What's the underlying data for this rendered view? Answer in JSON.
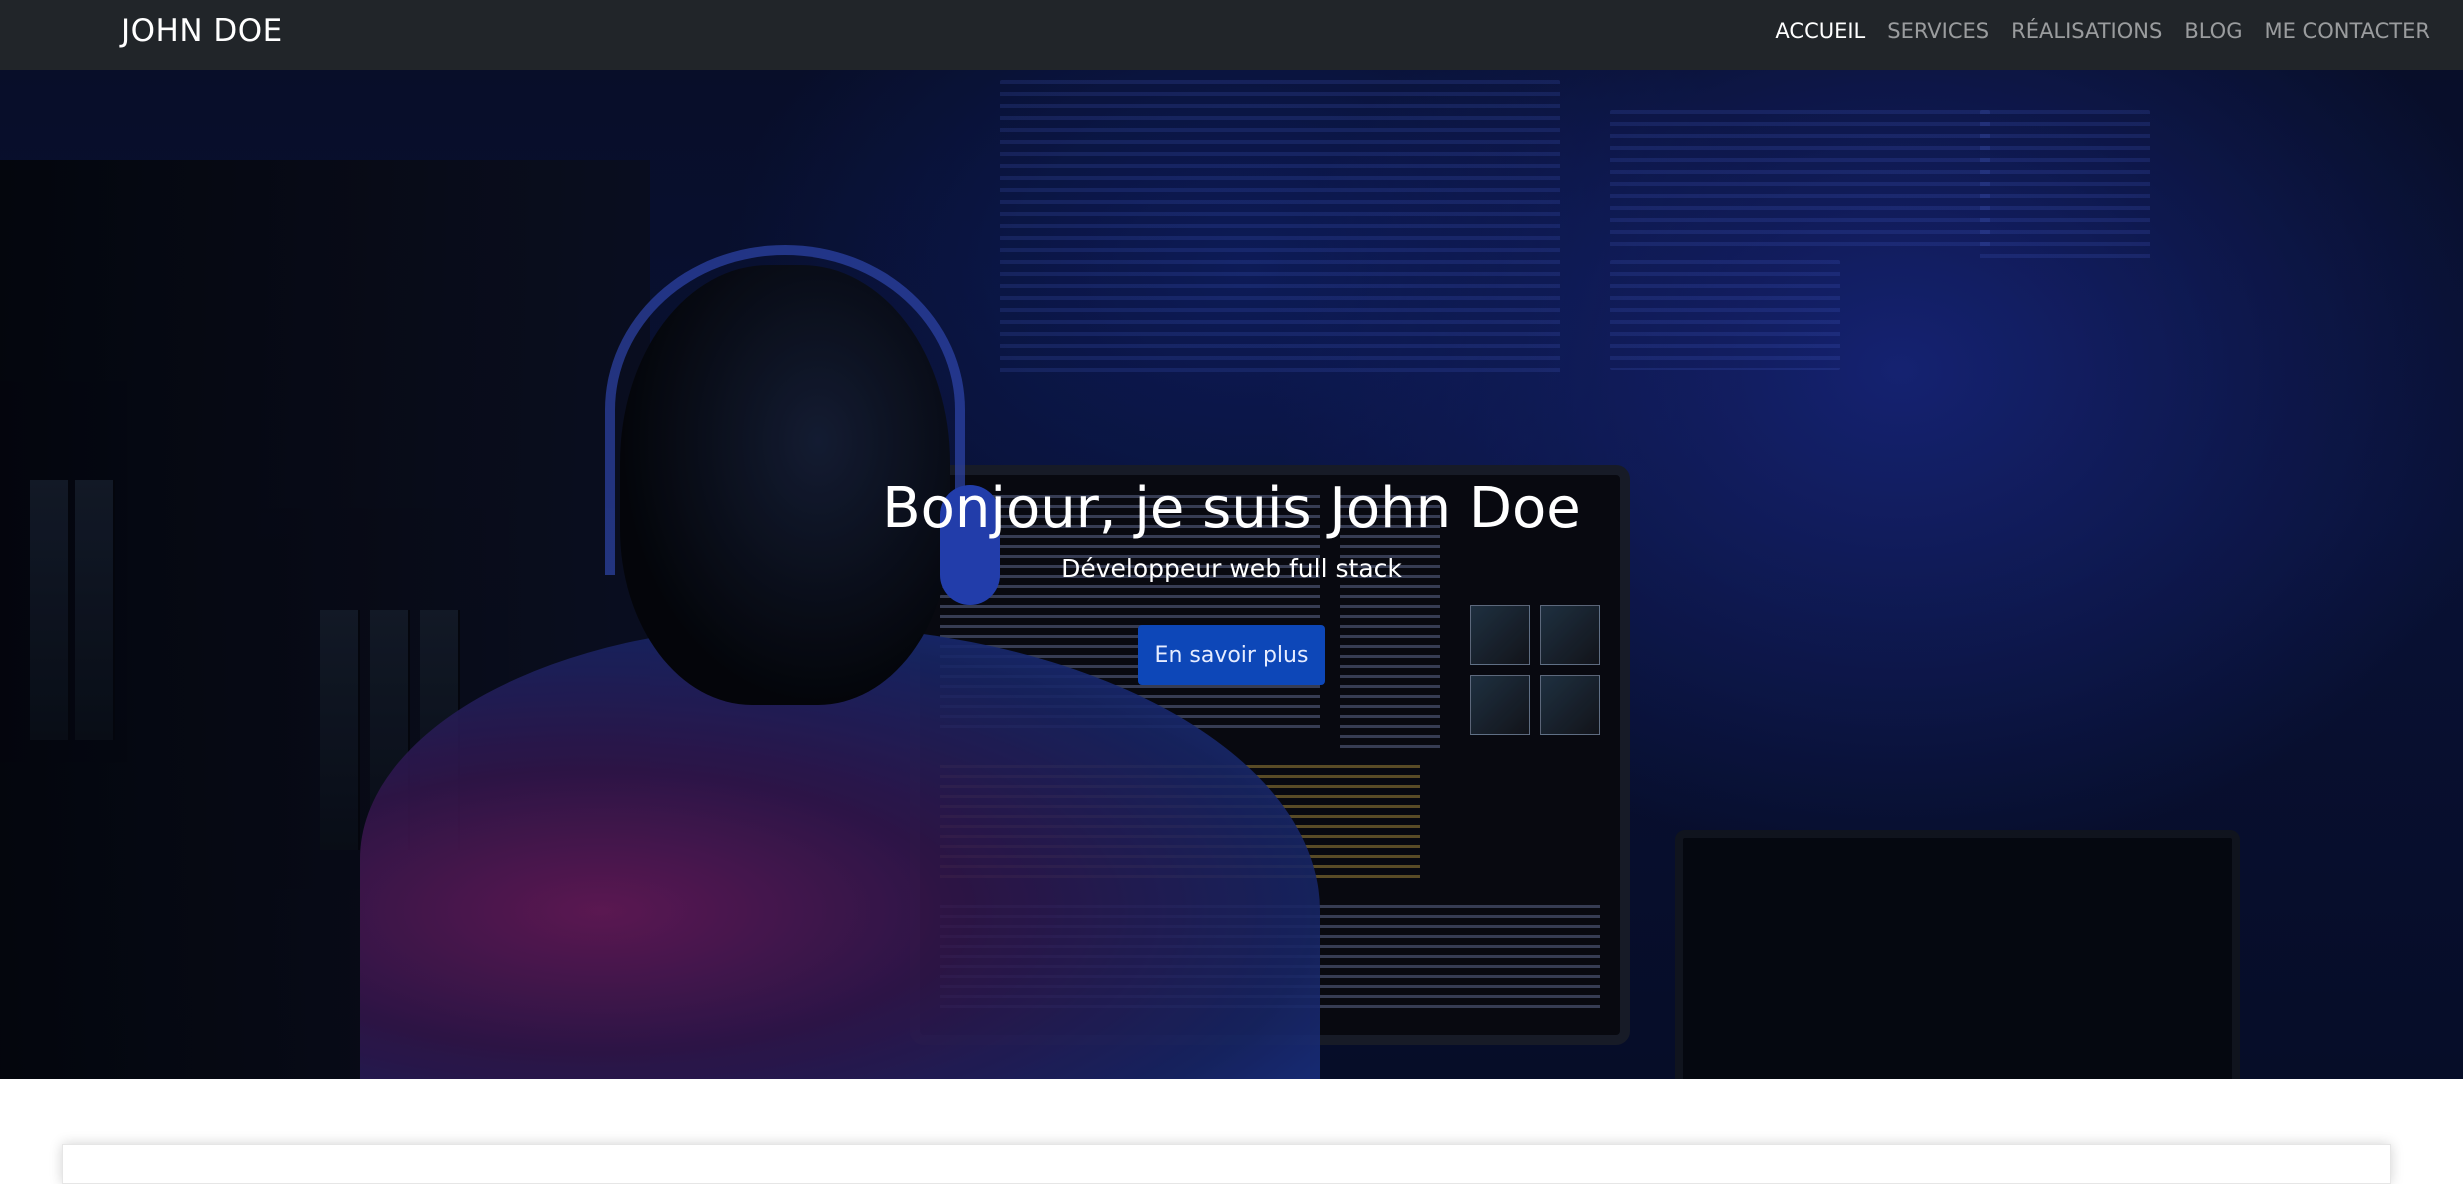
{
  "navbar": {
    "brand": "JOHN DOE",
    "links": [
      {
        "label": "ACCUEIL",
        "active": true
      },
      {
        "label": "SERVICES",
        "active": false
      },
      {
        "label": "RÉALISATIONS",
        "active": false
      },
      {
        "label": "BLOG",
        "active": false
      },
      {
        "label": "ME CONTACTER",
        "active": false
      }
    ]
  },
  "hero": {
    "title": "Bonjour, je suis John Doe",
    "subtitle": "Développeur web full stack",
    "button_label": "En savoir plus",
    "background_image": "developer-with-headphones-at-computer-photo"
  },
  "colors": {
    "navbar_bg": "#212529",
    "nav_active": "#ffffff",
    "nav_inactive": "#8c8f93",
    "button_bg": "#0d47b8",
    "hero_tint": "#0b1540"
  }
}
